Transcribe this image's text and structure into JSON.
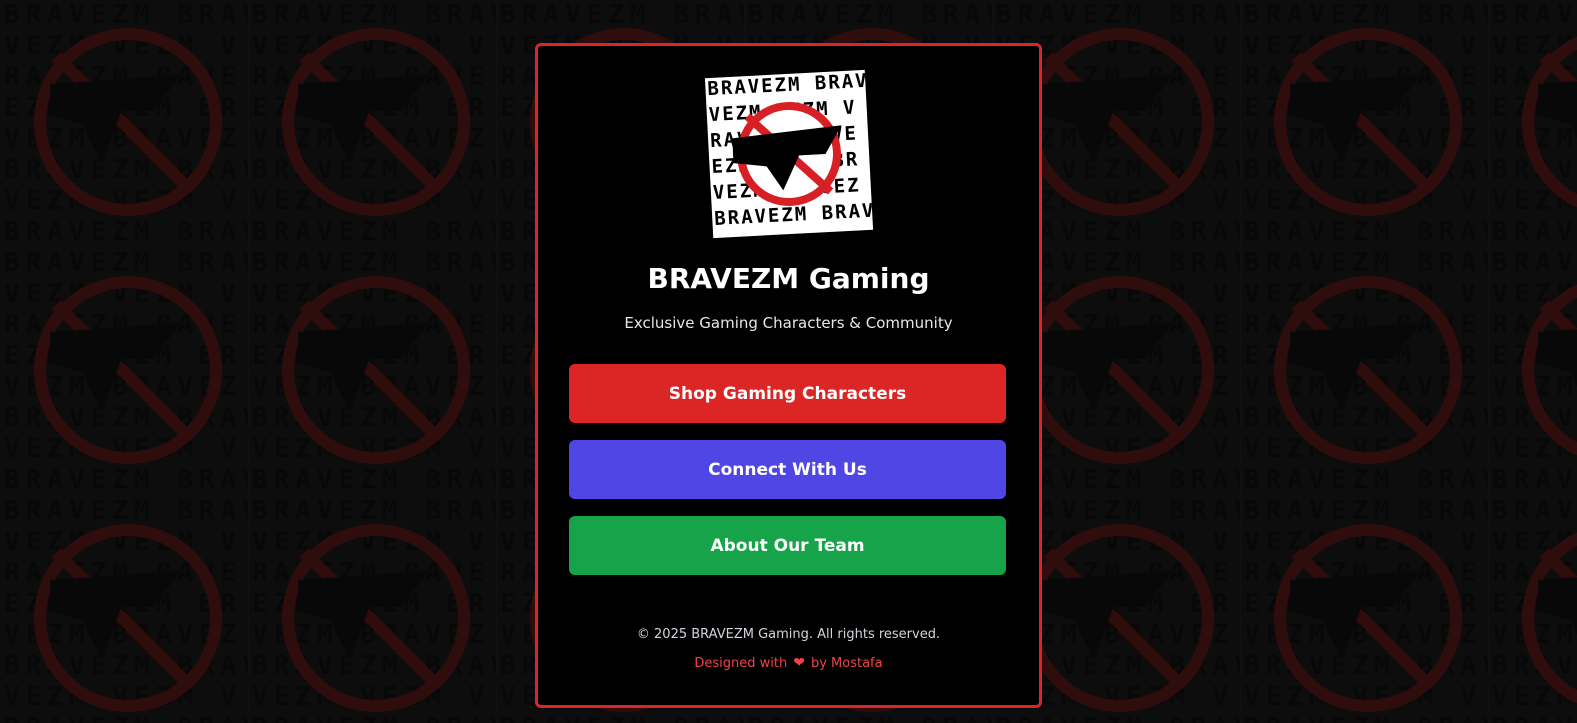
{
  "brand": {
    "logo_text": "BRAVEZM",
    "title": "BRAVEZM Gaming",
    "subtitle": "Exclusive Gaming Characters & Community"
  },
  "buttons": {
    "shop": "Shop Gaming Characters",
    "connect": "Connect With Us",
    "about": "About Our Team"
  },
  "footer": {
    "copyright": "© 2025 BRAVEZM Gaming. All rights reserved.",
    "designed_prefix": "Designed with",
    "heart_icon": "heart-icon",
    "designed_suffix": "by Mostafa"
  },
  "colors": {
    "accent_red": "#dc2626",
    "connect_indigo": "#4f46e5",
    "about_green": "#16a34a",
    "background": "#0a0a0a"
  }
}
